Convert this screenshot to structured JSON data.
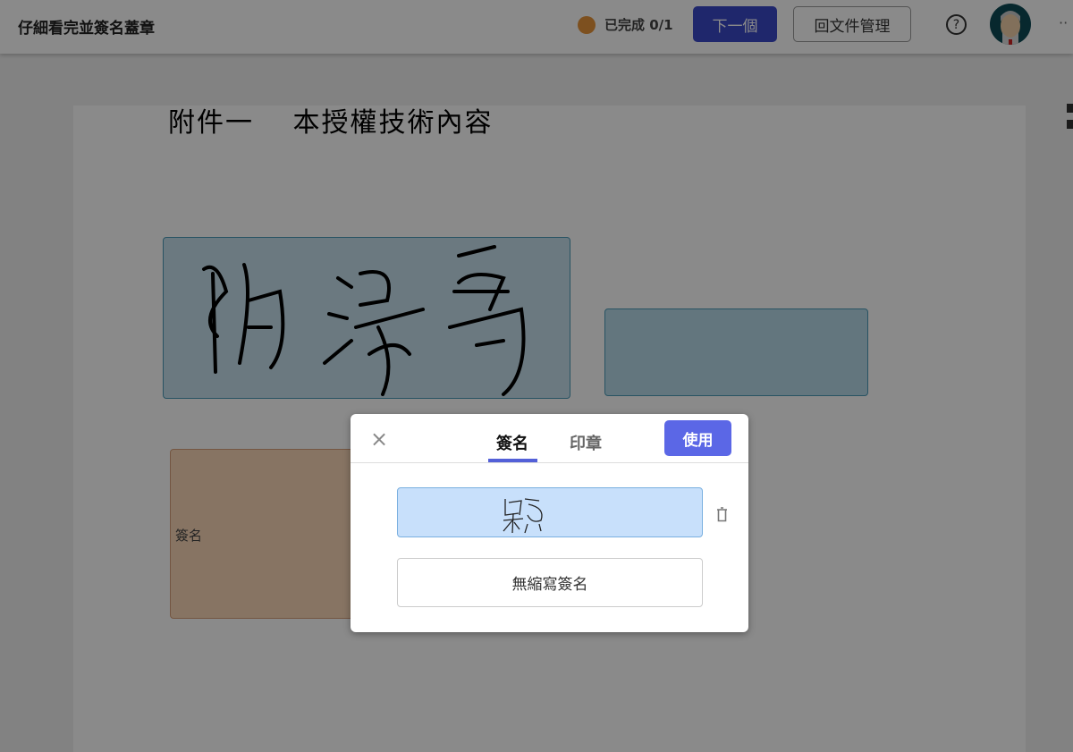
{
  "header": {
    "title": "仔細看完並簽名蓋章",
    "status": "已完成 0/1",
    "status_color": "#e8953a",
    "next_label": "下一個",
    "back_label": "回文件管理",
    "help_icon": "?",
    "more_icon": "··"
  },
  "document": {
    "heading": "附件一　 本授權技術內容",
    "field_label": "簽名"
  },
  "dialog": {
    "close_icon": "×",
    "tabs": [
      {
        "label": "簽名",
        "active": true
      },
      {
        "label": "印章",
        "active": false
      }
    ],
    "use_label": "使用",
    "no_abbr_label": "無縮寫簽名",
    "accent": "#5b67e6"
  }
}
